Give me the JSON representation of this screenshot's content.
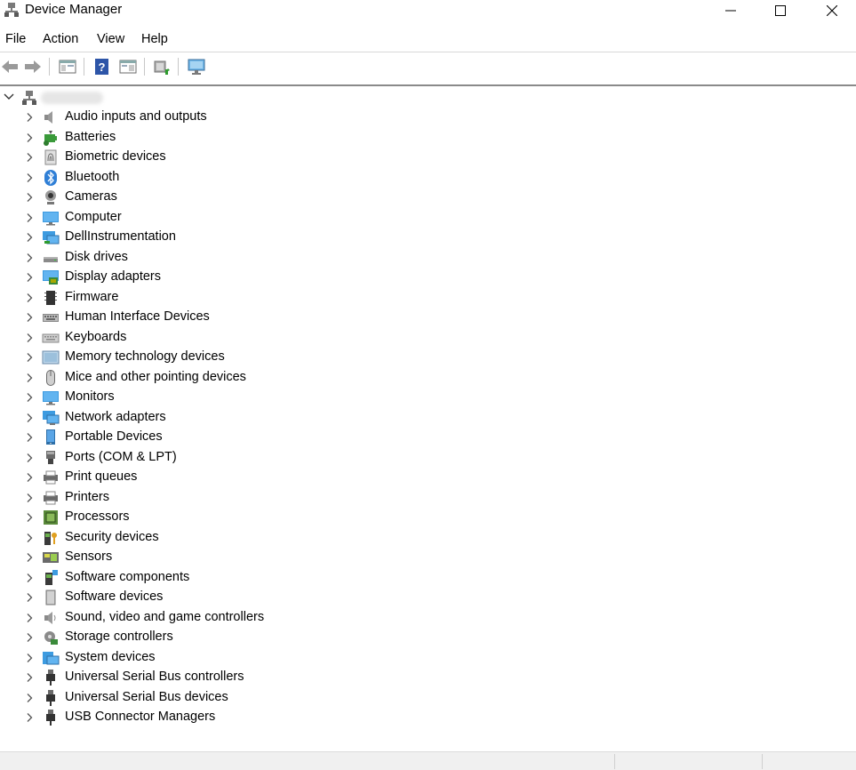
{
  "window": {
    "title": "Device Manager"
  },
  "menu": {
    "items": [
      "File",
      "Action",
      "View",
      "Help"
    ]
  },
  "toolbar": {
    "buttons": [
      "back-icon",
      "forward-icon",
      "show-hide-console-tree-icon",
      "help-icon",
      "action-pane-icon",
      "update-driver-icon",
      "scan-hardware-icon"
    ]
  },
  "tree": {
    "root": {
      "label_redacted": true,
      "expanded": true
    },
    "categories": [
      {
        "label": "Audio inputs and outputs",
        "icon": "speaker-icon"
      },
      {
        "label": "Batteries",
        "icon": "battery-icon"
      },
      {
        "label": "Biometric devices",
        "icon": "fingerprint-icon"
      },
      {
        "label": "Bluetooth",
        "icon": "bluetooth-icon"
      },
      {
        "label": "Cameras",
        "icon": "camera-icon"
      },
      {
        "label": "Computer",
        "icon": "computer-icon"
      },
      {
        "label": "DellInstrumentation",
        "icon": "network-monitor-icon"
      },
      {
        "label": "Disk drives",
        "icon": "disk-drive-icon"
      },
      {
        "label": "Display adapters",
        "icon": "display-adapter-icon"
      },
      {
        "label": "Firmware",
        "icon": "firmware-chip-icon"
      },
      {
        "label": "Human Interface Devices",
        "icon": "hid-keyboard-icon"
      },
      {
        "label": "Keyboards",
        "icon": "keyboard-icon"
      },
      {
        "label": "Memory technology devices",
        "icon": "memory-icon"
      },
      {
        "label": "Mice and other pointing devices",
        "icon": "mouse-icon"
      },
      {
        "label": "Monitors",
        "icon": "monitor-icon"
      },
      {
        "label": "Network adapters",
        "icon": "network-adapter-icon"
      },
      {
        "label": "Portable Devices",
        "icon": "portable-device-icon"
      },
      {
        "label": "Ports (COM & LPT)",
        "icon": "port-icon"
      },
      {
        "label": "Print queues",
        "icon": "print-queue-icon"
      },
      {
        "label": "Printers",
        "icon": "printer-icon"
      },
      {
        "label": "Processors",
        "icon": "processor-icon"
      },
      {
        "label": "Security devices",
        "icon": "security-key-icon"
      },
      {
        "label": "Sensors",
        "icon": "sensor-icon"
      },
      {
        "label": "Software components",
        "icon": "software-component-icon"
      },
      {
        "label": "Software devices",
        "icon": "software-device-icon"
      },
      {
        "label": "Sound, video and game controllers",
        "icon": "sound-controller-icon"
      },
      {
        "label": "Storage controllers",
        "icon": "storage-controller-icon"
      },
      {
        "label": "System devices",
        "icon": "system-device-icon"
      },
      {
        "label": "Universal Serial Bus controllers",
        "icon": "usb-icon"
      },
      {
        "label": "Universal Serial Bus devices",
        "icon": "usb-icon"
      },
      {
        "label": "USB Connector Managers",
        "icon": "usb-icon"
      }
    ]
  }
}
